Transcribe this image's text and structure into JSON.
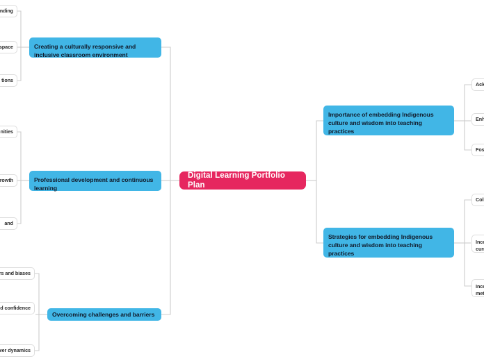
{
  "diagram": {
    "type": "mind-map",
    "background_color": "#ffffff",
    "connector_color": "#cccccc",
    "root": {
      "label": "Digital Learning Portfolio Plan",
      "color": "#e6275f",
      "text_color": "#ffffff"
    },
    "branch_color": "#41b6e6",
    "branch_text_color": "#111b2b",
    "leaf_color": "#ffffff",
    "leaf_border_color": "#dddddd",
    "leaf_text_color": "#2b2b2b"
  },
  "branches": {
    "right_top": {
      "label": "Importance of embedding Indigenous culture and wisdom into teaching practices",
      "children": [
        {
          "label": "Ackn"
        },
        {
          "label": "Enha"
        },
        {
          "label": "Foste"
        }
      ]
    },
    "right_bottom": {
      "label": "Strategies for embedding Indigenous culture and wisdom into teaching practices",
      "children": [
        {
          "label": "Colla"
        },
        {
          "label": "Incor\ncurricu"
        },
        {
          "label": "Incor\nmeth"
        }
      ]
    },
    "left_top": {
      "label": "Creating a culturally responsive and inclusive classroom environment",
      "children": [
        {
          "label": "nding"
        },
        {
          "label": "space"
        },
        {
          "label": "tions"
        }
      ]
    },
    "left_middle": {
      "label": "Professional development and continuous learning",
      "children": [
        {
          "label": "nities"
        },
        {
          "label": "rowth"
        },
        {
          "label": "and"
        }
      ]
    },
    "left_bottom": {
      "label": "Overcoming challenges and barriers",
      "children": [
        {
          "label": "rs and biases"
        },
        {
          "label": "d confidence"
        },
        {
          "label": "wer dynamics"
        }
      ]
    }
  }
}
